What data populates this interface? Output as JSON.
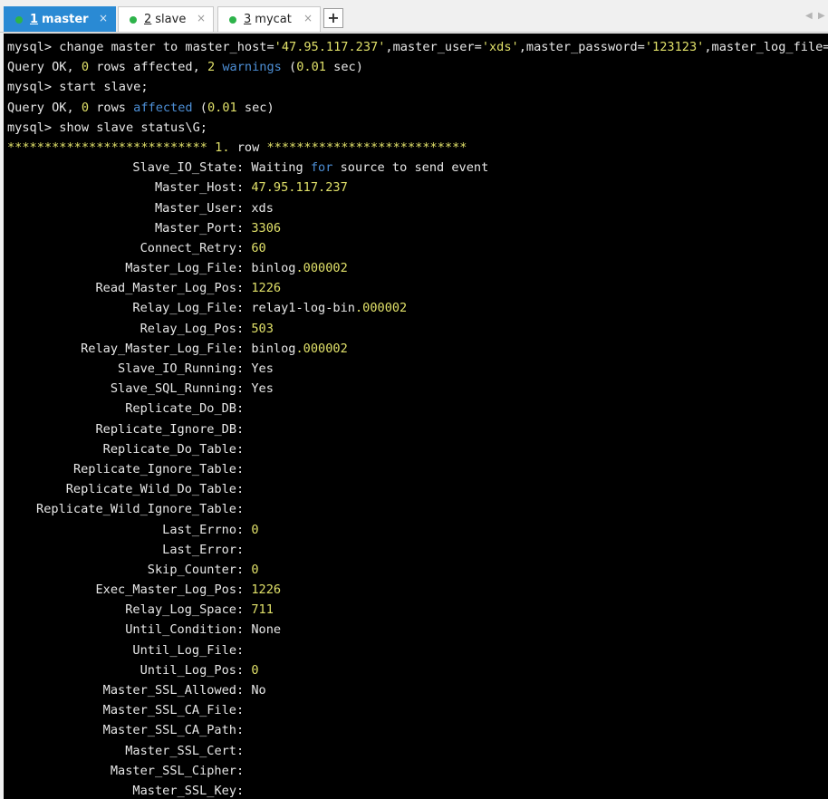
{
  "tabs": [
    {
      "number": "1",
      "label": "master",
      "active": true
    },
    {
      "number": "2",
      "label": "slave",
      "active": false
    },
    {
      "number": "3",
      "label": "mycat",
      "active": false
    }
  ],
  "tab_close_glyph": "×",
  "new_tab_glyph": "+",
  "scroll_left_glyph": "◀",
  "scroll_right_glyph": "▶",
  "colors": {
    "terminal_bg": "#000000",
    "text": "#e8e8e8",
    "number": "#e0e069",
    "keyword": "#4d8fd6",
    "tab_active": "#2a8ad4",
    "status_dot": "#2db34a"
  },
  "icons": {
    "status_dot": "status-dot-icon",
    "close": "close-icon",
    "new_tab": "plus-icon"
  },
  "terminal": {
    "prompt": "mysql> ",
    "cmd_change_master": {
      "pre": "change master to master_host=",
      "host": "'47.95.117.237'",
      "sep1": ",master_user=",
      "user": "'xds'",
      "sep2": ",master_password=",
      "password": "'123123'",
      "sep3": ",master_log_file="
    },
    "result1": {
      "pre": "Query OK, ",
      "rows": "0",
      "mid": " rows affected, ",
      "warn_count": "2",
      "warn_word": " warnings",
      "time_open": " (",
      "time": "0.01",
      "time_close": " sec)"
    },
    "cmd_start_slave": "start slave;",
    "result2": {
      "pre": "Query OK, ",
      "rows": "0",
      "mid": " rows ",
      "affected": "affected",
      "time_open": " (",
      "time": "0.01",
      "time_close": " sec)"
    },
    "cmd_show_status": "show slave status\\G;",
    "row_header": {
      "stars_left": "***************************",
      "number": " 1.",
      "word": " row ",
      "stars_right": "***************************"
    },
    "status_fields": [
      {
        "key": "Slave_IO_State",
        "value": "Waiting ",
        "value_kw": "for",
        "value_rest": " source to send event"
      },
      {
        "key": "Master_Host",
        "value_num": "47.95.117.237"
      },
      {
        "key": "Master_User",
        "value": "xds"
      },
      {
        "key": "Master_Port",
        "value_num": "3306"
      },
      {
        "key": "Connect_Retry",
        "value_num": "60"
      },
      {
        "key": "Master_Log_File",
        "value": "binlog",
        "value_num_suffix": ".000002"
      },
      {
        "key": "Read_Master_Log_Pos",
        "value_num": "1226"
      },
      {
        "key": "Relay_Log_File",
        "value": "relay1-log-bin",
        "value_num_suffix": ".000002"
      },
      {
        "key": "Relay_Log_Pos",
        "value_num": "503"
      },
      {
        "key": "Relay_Master_Log_File",
        "value": "binlog",
        "value_num_suffix": ".000002"
      },
      {
        "key": "Slave_IO_Running",
        "value": "Yes"
      },
      {
        "key": "Slave_SQL_Running",
        "value": "Yes"
      },
      {
        "key": "Replicate_Do_DB",
        "value": ""
      },
      {
        "key": "Replicate_Ignore_DB",
        "value": ""
      },
      {
        "key": "Replicate_Do_Table",
        "value": ""
      },
      {
        "key": "Replicate_Ignore_Table",
        "value": ""
      },
      {
        "key": "Replicate_Wild_Do_Table",
        "value": ""
      },
      {
        "key": "Replicate_Wild_Ignore_Table",
        "value": ""
      },
      {
        "key": "Last_Errno",
        "value_num": "0"
      },
      {
        "key": "Last_Error",
        "value": ""
      },
      {
        "key": "Skip_Counter",
        "value_num": "0"
      },
      {
        "key": "Exec_Master_Log_Pos",
        "value_num": "1226"
      },
      {
        "key": "Relay_Log_Space",
        "value_num": "711"
      },
      {
        "key": "Until_Condition",
        "value": "None"
      },
      {
        "key": "Until_Log_File",
        "value": ""
      },
      {
        "key": "Until_Log_Pos",
        "value_num": "0"
      },
      {
        "key": "Master_SSL_Allowed",
        "value": "No"
      },
      {
        "key": "Master_SSL_CA_File",
        "value": ""
      },
      {
        "key": "Master_SSL_CA_Path",
        "value": ""
      },
      {
        "key": "Master_SSL_Cert",
        "value": ""
      },
      {
        "key": "Master_SSL_Cipher",
        "value": ""
      },
      {
        "key": "Master_SSL_Key",
        "value": ""
      }
    ]
  }
}
